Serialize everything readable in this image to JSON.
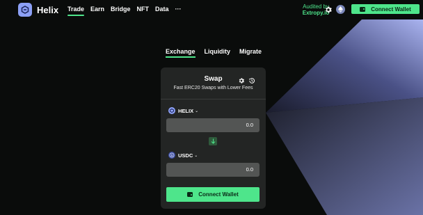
{
  "app": {
    "name": "Helix"
  },
  "nav": [
    {
      "label": "Trade",
      "active": true
    },
    {
      "label": "Earn"
    },
    {
      "label": "Bridge"
    },
    {
      "label": "NFT"
    },
    {
      "label": "Data"
    },
    {
      "label": "···"
    }
  ],
  "audit": {
    "line1": "Audited by",
    "line2": "Extropy.io"
  },
  "header": {
    "connect_label": "Connect Wallet"
  },
  "tabs": [
    {
      "label": "Exchange",
      "active": true
    },
    {
      "label": "Liquidity"
    },
    {
      "label": "Migrate"
    }
  ],
  "swap": {
    "title": "Swap",
    "subtitle": "Fast ERC20 Swaps with Lower Fees",
    "from": {
      "token": "HELIX",
      "amount": "0.0"
    },
    "to": {
      "token": "USDC",
      "amount": "0.0"
    },
    "connect_label": "Connect Wallet"
  },
  "colors": {
    "accent": "#4ee58b",
    "background": "#0a0c0b",
    "card": "#232524",
    "input": "#535554"
  }
}
